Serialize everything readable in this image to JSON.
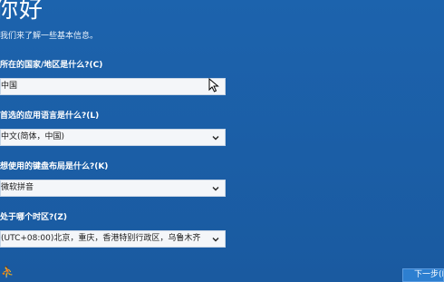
{
  "header": {
    "title": "你好",
    "subtitle": "我们来了解一些基本信息。"
  },
  "form": {
    "region": {
      "label": "所在的国家/地区是什么?(C)",
      "value": "中国"
    },
    "app_language": {
      "label": "首选的应用语言是什么?(L)",
      "value": "中文(简体，中国)"
    },
    "keyboard": {
      "label": "想使用的键盘布局是什么?(K)",
      "value": "微软拼音"
    },
    "timezone": {
      "label": "处于哪个时区?(Z)",
      "value": "(UTC+08:00)北京，重庆，香港特别行政区，乌鲁木齐"
    }
  },
  "footer": {
    "accessibility_glyph": "⛹",
    "next_label": "下一步(N)"
  },
  "icons": {
    "dropdown": "chevron-down-icon",
    "cursor": "mouse-pointer-icon",
    "accessibility": "ease-of-access-icon"
  },
  "colors": {
    "background": "#1c63ad",
    "field_background": "#f4f6f9",
    "next_button": "#2d7fd0"
  }
}
